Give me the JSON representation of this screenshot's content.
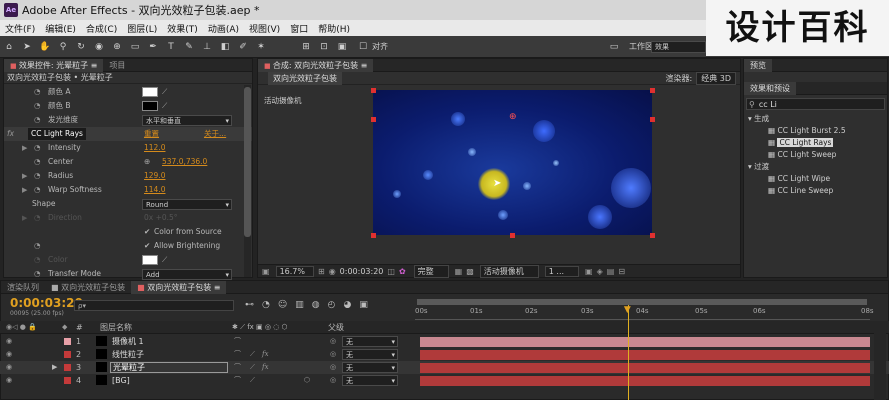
{
  "title_bar": {
    "app_icon": "Ae",
    "title": "Adobe After Effects - 双向光效粒子包装.aep *"
  },
  "watermark": "设计百科",
  "menu": [
    "文件(F)",
    "编辑(E)",
    "合成(C)",
    "图层(L)",
    "效果(T)",
    "动画(A)",
    "视图(V)",
    "窗口",
    "帮助(H)"
  ],
  "toolbar": {
    "align_label": "对齐",
    "workspace_label": "工作区:",
    "workspace_value": "效果"
  },
  "effect_controls": {
    "tabs": [
      "效果控件: 光晕粒子",
      "项目"
    ],
    "header": "双向光效粒子包装 • 光晕粒子",
    "rows": [
      {
        "label": "颜色 A"
      },
      {
        "label": "颜色 B"
      },
      {
        "label": "发光维度",
        "value": "水平和垂直"
      },
      {
        "label": "CC Light Rays",
        "reset": "重置",
        "about": "关于..."
      },
      {
        "label": "Intensity",
        "value": "112.0"
      },
      {
        "label": "Center",
        "value": "537.0,736.0"
      },
      {
        "label": "Radius",
        "value": "129.0"
      },
      {
        "label": "Warp Softness",
        "value": "114.0"
      },
      {
        "label": "Shape",
        "value": "Round"
      },
      {
        "label": "Direction",
        "value": "0x +0.5°"
      },
      {
        "label": "Color from Source"
      },
      {
        "label": "Allow Brightening"
      },
      {
        "label": "Color"
      },
      {
        "label": "Transfer Mode",
        "value": "Add"
      }
    ]
  },
  "composition": {
    "tab": "合成: 双向光效粒子包装",
    "subtab": "双向光效粒子包装",
    "renderer_label": "渲染器:",
    "renderer_value": "经典 3D",
    "camera_label": "活动摄像机",
    "footer": {
      "zoom": "16.7%",
      "timecode": "0:00:03:20",
      "quality": "完整",
      "view": "活动摄像机",
      "views_count": "1 ..."
    }
  },
  "right_panel": {
    "preview_tab": "预览",
    "effects_tab": "效果和预设",
    "search_value": "cc Li",
    "groups": [
      {
        "name": "生成",
        "items": [
          "CC Light Burst 2.5",
          "CC Light Rays",
          "CC Light Sweep"
        ]
      },
      {
        "name": "过渡",
        "items": [
          "CC Light Wipe",
          "CC Line Sweep"
        ]
      }
    ],
    "selected_item": "CC Light Rays"
  },
  "timeline": {
    "tabs": [
      "渲染队列",
      "双向光效粒子包装",
      "双向光效粒子包装"
    ],
    "timecode": "0:00:03:20",
    "frames": "00095 (25.00 fps)",
    "search_placeholder": "ρ▾",
    "columns": {
      "num": "#",
      "name": "图层名称",
      "switches": "✱ ⟋ fx ▣ ◎ ◌ ⬡",
      "parent": "父级"
    },
    "ruler": [
      "00s",
      "01s",
      "02s",
      "03s",
      "04s",
      "05s",
      "06s",
      "08s"
    ],
    "playhead_seconds": 3.8,
    "layers": [
      {
        "num": "1",
        "name": "摄像机 1",
        "color": "#e8a0a8",
        "parent": "无"
      },
      {
        "num": "2",
        "name": "线性粒子",
        "color": "#c43a3a",
        "parent": "无"
      },
      {
        "num": "3",
        "name": "光晕粒子",
        "color": "#c43a3a",
        "parent": "无"
      },
      {
        "num": "4",
        "name": "[BG]",
        "color": "#c43a3a",
        "parent": "无"
      }
    ]
  },
  "colors": {
    "accent_orange": "#e0a020",
    "layer_bar": "#b03a3a",
    "camera_bar": "#c88890",
    "playhead": "#e0b020"
  }
}
